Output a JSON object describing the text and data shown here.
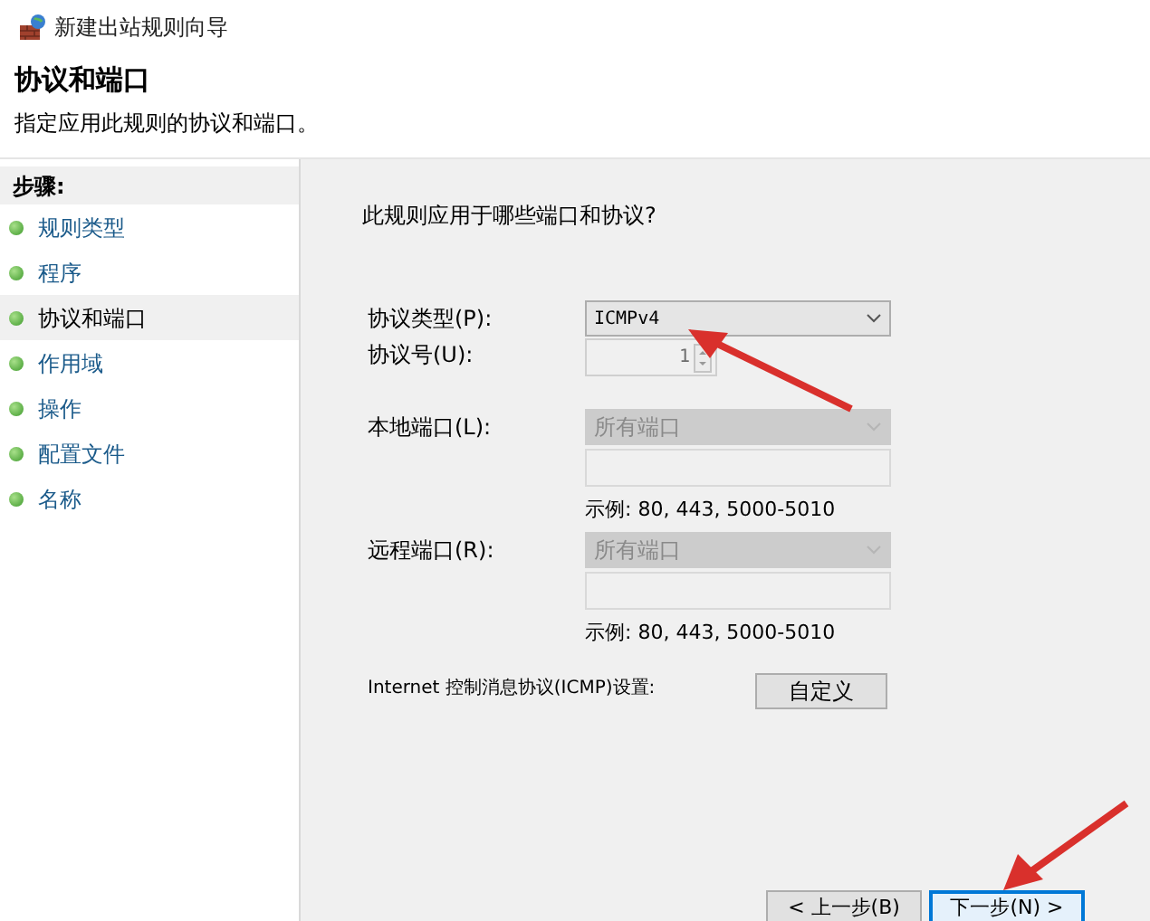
{
  "window": {
    "title": "新建出站规则向导"
  },
  "header": {
    "title": "协议和端口",
    "subtitle": "指定应用此规则的协议和端口。"
  },
  "steps": {
    "heading": "步骤:",
    "items": [
      {
        "label": "规则类型",
        "selected": false
      },
      {
        "label": "程序",
        "selected": false
      },
      {
        "label": "协议和端口",
        "selected": true
      },
      {
        "label": "作用域",
        "selected": false
      },
      {
        "label": "操作",
        "selected": false
      },
      {
        "label": "配置文件",
        "selected": false
      },
      {
        "label": "名称",
        "selected": false
      }
    ]
  },
  "question": "此规则应用于哪些端口和协议?",
  "protocol_type": {
    "label": "协议类型(P):",
    "value": "ICMPv4",
    "disabled": false
  },
  "protocol_number": {
    "label": "协议号(U):",
    "value": "1",
    "disabled": true
  },
  "local_port": {
    "label": "本地端口(L):",
    "value": "所有端口",
    "disabled": true,
    "example": "示例: 80, 443, 5000-5010"
  },
  "remote_port": {
    "label": "远程端口(R):",
    "value": "所有端口",
    "disabled": true,
    "example": "示例: 80, 443, 5000-5010"
  },
  "icmp": {
    "label": "Internet 控制消息协议(ICMP)设置:",
    "button": "自定义"
  },
  "buttons": [
    {
      "label": "< 上一步(B)",
      "selected": false
    },
    {
      "label": "下一步(N) >",
      "selected": true
    }
  ]
}
